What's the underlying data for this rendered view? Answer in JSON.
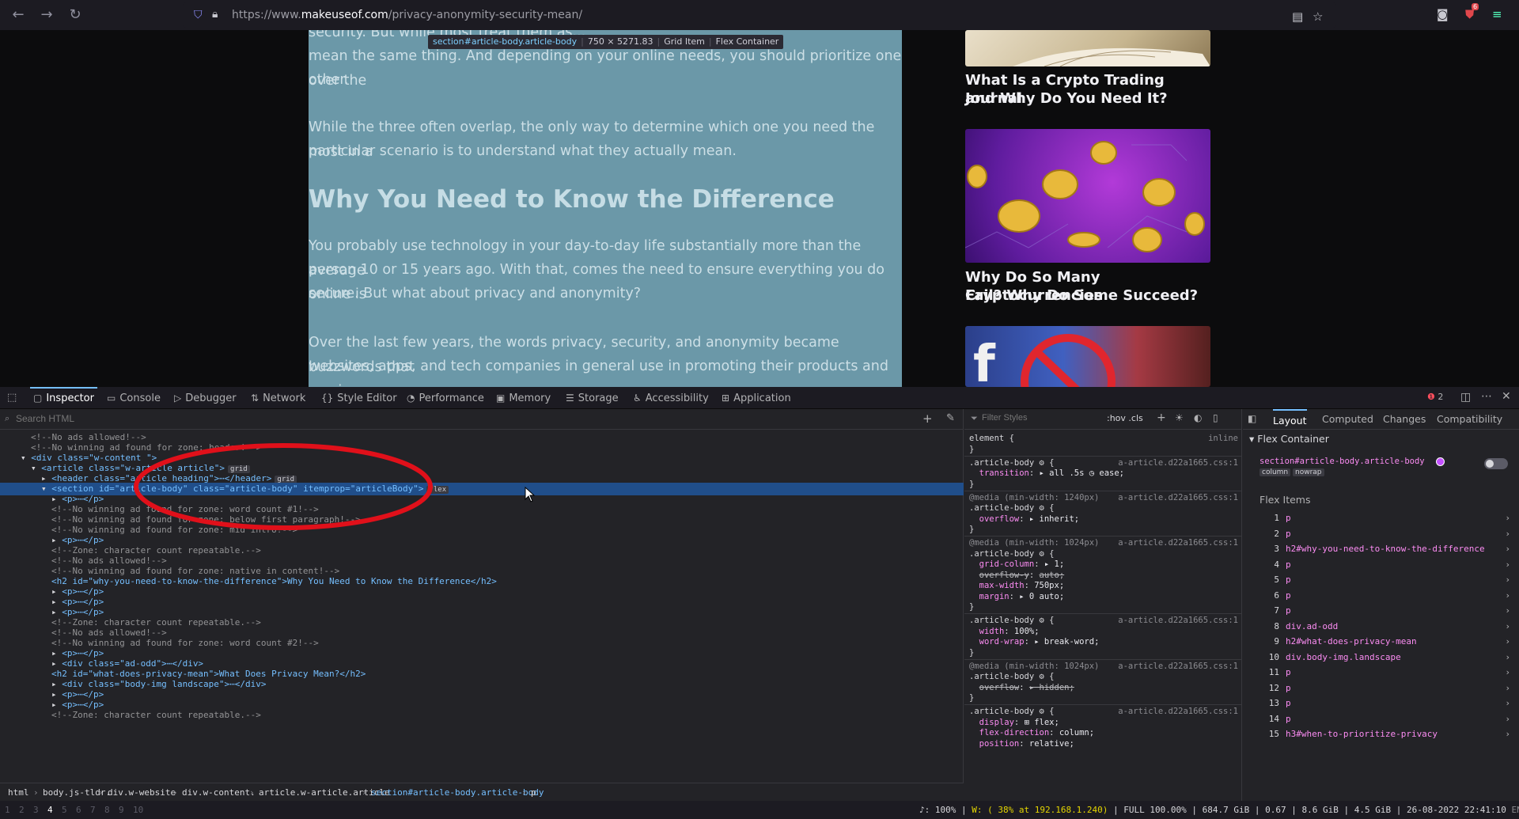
{
  "browser": {
    "url_scheme": "https://www.",
    "url_host": "makeuseof.com",
    "url_path": "/privacy-anonymity-security-mean/",
    "notification_count": "6"
  },
  "article": {
    "para1_line1": "security. But while most treat them as...",
    "para1_line2": "mean the same thing. And depending on your online needs, you should prioritize one over the",
    "para1_line3": "other.",
    "para2_line1": "While the three often overlap, the only way to determine which one you need the most in a",
    "para2_line2": "particular scenario is to understand what they actually mean.",
    "heading": "Why You Need to Know the Difference",
    "para3_line1": "You probably use technology in your day-to-day life substantially more than the average",
    "para3_line2": "person 10 or 15 years ago. With that, comes the need to ensure everything you do online is",
    "para3_line3": "secure. But what about privacy and anonymity?",
    "para4_line1": "Over the last few years, the words privacy, security, and anonymity became buzzwords that",
    "para4_line2": "websites, apps, and tech companies in general use in promoting their products and services"
  },
  "highlighter": {
    "selector": "section#article-body.article-body",
    "dimensions": "750 × 5271.83",
    "type1": "Grid Item",
    "type2": "Flex Container"
  },
  "sidebar_cards": [
    {
      "title_l1": "What Is a Crypto Trading Journal",
      "title_l2": "and Why Do You Need It?"
    },
    {
      "title_l1": "Why Do So Many Cryptocurrencies",
      "title_l2": "Fail? Why Do Some Succeed?"
    }
  ],
  "devtools": {
    "tabs": [
      "Inspector",
      "Console",
      "Debugger",
      "Network",
      "Style Editor",
      "Performance",
      "Memory",
      "Storage",
      "Accessibility",
      "Application"
    ],
    "error_count": "2",
    "search_placeholder": "Search HTML",
    "filter_placeholder": "Filter Styles",
    "hov_cls": ":hov .cls",
    "layout_tabs": [
      "Layout",
      "Computed",
      "Changes",
      "Compatibility"
    ],
    "flex_container_label": "Flex Container",
    "flex_container_selector": "section#article-body.article-body",
    "flex_badges": [
      "column",
      "nowrap"
    ],
    "flex_items_label": "Flex Items",
    "flex_items": [
      {
        "n": "1",
        "s": "p"
      },
      {
        "n": "2",
        "s": "p"
      },
      {
        "n": "3",
        "s": "h2#why-you-need-to-know-the-difference"
      },
      {
        "n": "4",
        "s": "p"
      },
      {
        "n": "5",
        "s": "p"
      },
      {
        "n": "6",
        "s": "p"
      },
      {
        "n": "7",
        "s": "p"
      },
      {
        "n": "8",
        "s": "div.ad-odd"
      },
      {
        "n": "9",
        "s": "h2#what-does-privacy-mean"
      },
      {
        "n": "10",
        "s": "div.body-img.landscape"
      },
      {
        "n": "11",
        "s": "p"
      },
      {
        "n": "12",
        "s": "p"
      },
      {
        "n": "13",
        "s": "p"
      },
      {
        "n": "14",
        "s": "p"
      },
      {
        "n": "15",
        "s": "h3#when-to-prioritize-privacy"
      }
    ],
    "markup": [
      {
        "indent": 6,
        "t": "cm",
        "text": "<!--No ads allowed!-->"
      },
      {
        "indent": 6,
        "t": "cm",
        "text": "<!--No winning ad found for zone: header!-->"
      },
      {
        "indent": 4,
        "t": "open",
        "tw": "▾",
        "text": "<div class=\"w-content \">"
      },
      {
        "indent": 6,
        "t": "open",
        "tw": "▾",
        "text": "<article class=\"w-article article\">",
        "badge": "grid"
      },
      {
        "indent": 8,
        "t": "open",
        "tw": "▸",
        "text": "<header class=\"article heading\">⋯</header>",
        "badge": "grid"
      },
      {
        "indent": 8,
        "t": "sel",
        "tw": "▾",
        "text": "<section id=\"article-body\" class=\"article-body\" itemprop=\"articleBody\">",
        "badge": "flex"
      },
      {
        "indent": 10,
        "t": "open",
        "tw": "▸",
        "text": "<p>⋯</p>"
      },
      {
        "indent": 10,
        "t": "cm",
        "text": "<!--No winning ad found for zone: word count #1!-->"
      },
      {
        "indent": 10,
        "t": "cm",
        "text": "<!--No winning ad found for zone: below first paragraph!-->"
      },
      {
        "indent": 10,
        "t": "cm",
        "text": "<!--No winning ad found for zone: mid intro!-->"
      },
      {
        "indent": 10,
        "t": "open",
        "tw": "▸",
        "text": "<p>⋯</p>"
      },
      {
        "indent": 10,
        "t": "cm",
        "text": "<!--Zone: character count repeatable.-->"
      },
      {
        "indent": 10,
        "t": "cm",
        "text": "<!--No ads allowed!-->"
      },
      {
        "indent": 10,
        "t": "cm",
        "text": "<!--No winning ad found for zone: native in content!-->"
      },
      {
        "indent": 10,
        "t": "open",
        "tw": "",
        "text": "<h2 id=\"why-you-need-to-know-the-difference\">Why You Need to Know the Difference</h2>"
      },
      {
        "indent": 10,
        "t": "open",
        "tw": "▸",
        "text": "<p>⋯</p>"
      },
      {
        "indent": 10,
        "t": "open",
        "tw": "▸",
        "text": "<p>⋯</p>"
      },
      {
        "indent": 10,
        "t": "open",
        "tw": "▸",
        "text": "<p>⋯</p>"
      },
      {
        "indent": 10,
        "t": "cm",
        "text": "<!--Zone: character count repeatable.-->"
      },
      {
        "indent": 10,
        "t": "cm",
        "text": "<!--No ads allowed!-->"
      },
      {
        "indent": 10,
        "t": "cm",
        "text": "<!--No winning ad found for zone: word count #2!-->"
      },
      {
        "indent": 10,
        "t": "open",
        "tw": "▸",
        "text": "<p>⋯</p>"
      },
      {
        "indent": 10,
        "t": "open",
        "tw": "▸",
        "text": "<div class=\"ad-odd\">⋯</div>"
      },
      {
        "indent": 10,
        "t": "open",
        "tw": "",
        "text": "<h2 id=\"what-does-privacy-mean\">What Does Privacy Mean?</h2>"
      },
      {
        "indent": 10,
        "t": "open",
        "tw": "▸",
        "text": "<div class=\"body-img landscape\">⋯</div>"
      },
      {
        "indent": 10,
        "t": "open",
        "tw": "▸",
        "text": "<p>⋯</p>"
      },
      {
        "indent": 10,
        "t": "open",
        "tw": "▸",
        "text": "<p>⋯</p>"
      },
      {
        "indent": 10,
        "t": "cm",
        "text": "<!--Zone: character count repeatable.-->"
      }
    ],
    "breadcrumbs": [
      "html",
      "body.js-tldr.",
      "div.w-website",
      "div.w-content.",
      "article.w-article.article",
      "section#article-body.article-body",
      "p"
    ],
    "rules": [
      {
        "t": "sel",
        "text": "element {",
        "src": "inline"
      },
      {
        "t": "close",
        "text": "}"
      },
      {
        "t": "sel",
        "text": ".article-body ⚙ {",
        "src": "a-article.d22a1665.css:1"
      },
      {
        "t": "decl",
        "prop": "transition",
        "v": "▸ all .5s ◷ ease;"
      },
      {
        "t": "close",
        "text": "}"
      },
      {
        "t": "media",
        "text": "@media (min-width: 1240px)",
        "src": "a-article.d22a1665.css:1"
      },
      {
        "t": "sel",
        "text": ".article-body ⚙ {"
      },
      {
        "t": "decl",
        "prop": "overflow",
        "v": "▸ inherit;"
      },
      {
        "t": "close",
        "text": "}"
      },
      {
        "t": "media",
        "text": "@media (min-width: 1024px)",
        "src": "a-article.d22a1665.css:1"
      },
      {
        "t": "sel",
        "text": ".article-body ⚙ {"
      },
      {
        "t": "decl",
        "prop": "grid-column",
        "v": "▸ 1;"
      },
      {
        "t": "strike",
        "prop": "overflow-y",
        "v": "auto;"
      },
      {
        "t": "decl",
        "prop": "max-width",
        "v": "750px;"
      },
      {
        "t": "decl",
        "prop": "margin",
        "v": "▸ 0 auto;"
      },
      {
        "t": "close",
        "text": "}"
      },
      {
        "t": "sel",
        "text": ".article-body ⚙ {",
        "src": "a-article.d22a1665.css:1"
      },
      {
        "t": "decl",
        "prop": "width",
        "v": "100%;"
      },
      {
        "t": "decl",
        "prop": "word-wrap",
        "v": "▸ break-word;"
      },
      {
        "t": "close",
        "text": "}"
      },
      {
        "t": "media",
        "text": "@media (min-width: 1024px)",
        "src": "a-article.d22a1665.css:1"
      },
      {
        "t": "sel",
        "text": ".article-body ⚙ {"
      },
      {
        "t": "strike",
        "prop": "overflow",
        "v": "▸ hidden;"
      },
      {
        "t": "close",
        "text": "}"
      },
      {
        "t": "sel",
        "text": ".article-body ⚙ {",
        "src": "a-article.d22a1665.css:1"
      },
      {
        "t": "decl",
        "prop": "display",
        "v": "⊞ flex;"
      },
      {
        "t": "decl",
        "prop": "flex-direction",
        "v": "column;"
      },
      {
        "t": "decl",
        "prop": "position",
        "v": "relative;"
      }
    ]
  },
  "statusbar": {
    "workspaces": [
      "1",
      "2",
      "3",
      "4",
      "5",
      "6",
      "7",
      "8",
      "9",
      "10"
    ],
    "active_workspace": "4",
    "volume": "♪: 100%",
    "wifi": "W: ( 38% at 192.168.1.240)",
    "disk": "FULL 100.00%",
    "storage": "684.7 GiB",
    "load": "0.67",
    "ram": "8.6 GiB | 4.5 GiB",
    "datetime": "26-08-2022 22:41:10",
    "lang": "EN"
  }
}
